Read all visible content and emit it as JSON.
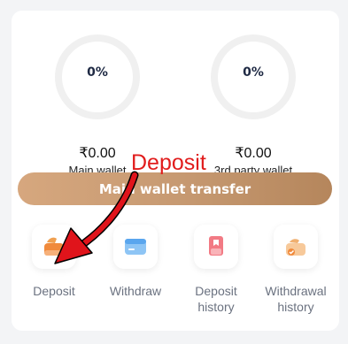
{
  "wallets": [
    {
      "percent": "0%",
      "amount": "₹0.00",
      "label": "Main wallet"
    },
    {
      "percent": "0%",
      "amount": "₹0.00",
      "label": "3rd party wallet"
    }
  ],
  "transfer_button": {
    "label": "Main wallet transfer"
  },
  "actions": [
    {
      "label": "Deposit",
      "icon": "wallet-icon"
    },
    {
      "label": "Withdraw",
      "icon": "card-icon"
    },
    {
      "label": "Deposit history",
      "icon": "document-icon"
    },
    {
      "label": "Withdrawal history",
      "icon": "wallet-check-icon"
    }
  ],
  "annotation": {
    "text": "Deposit",
    "color": "#e11d1d"
  },
  "colors": {
    "accent_start": "#d6a77e",
    "accent_end": "#b5865c",
    "text_muted": "#6b7280"
  }
}
